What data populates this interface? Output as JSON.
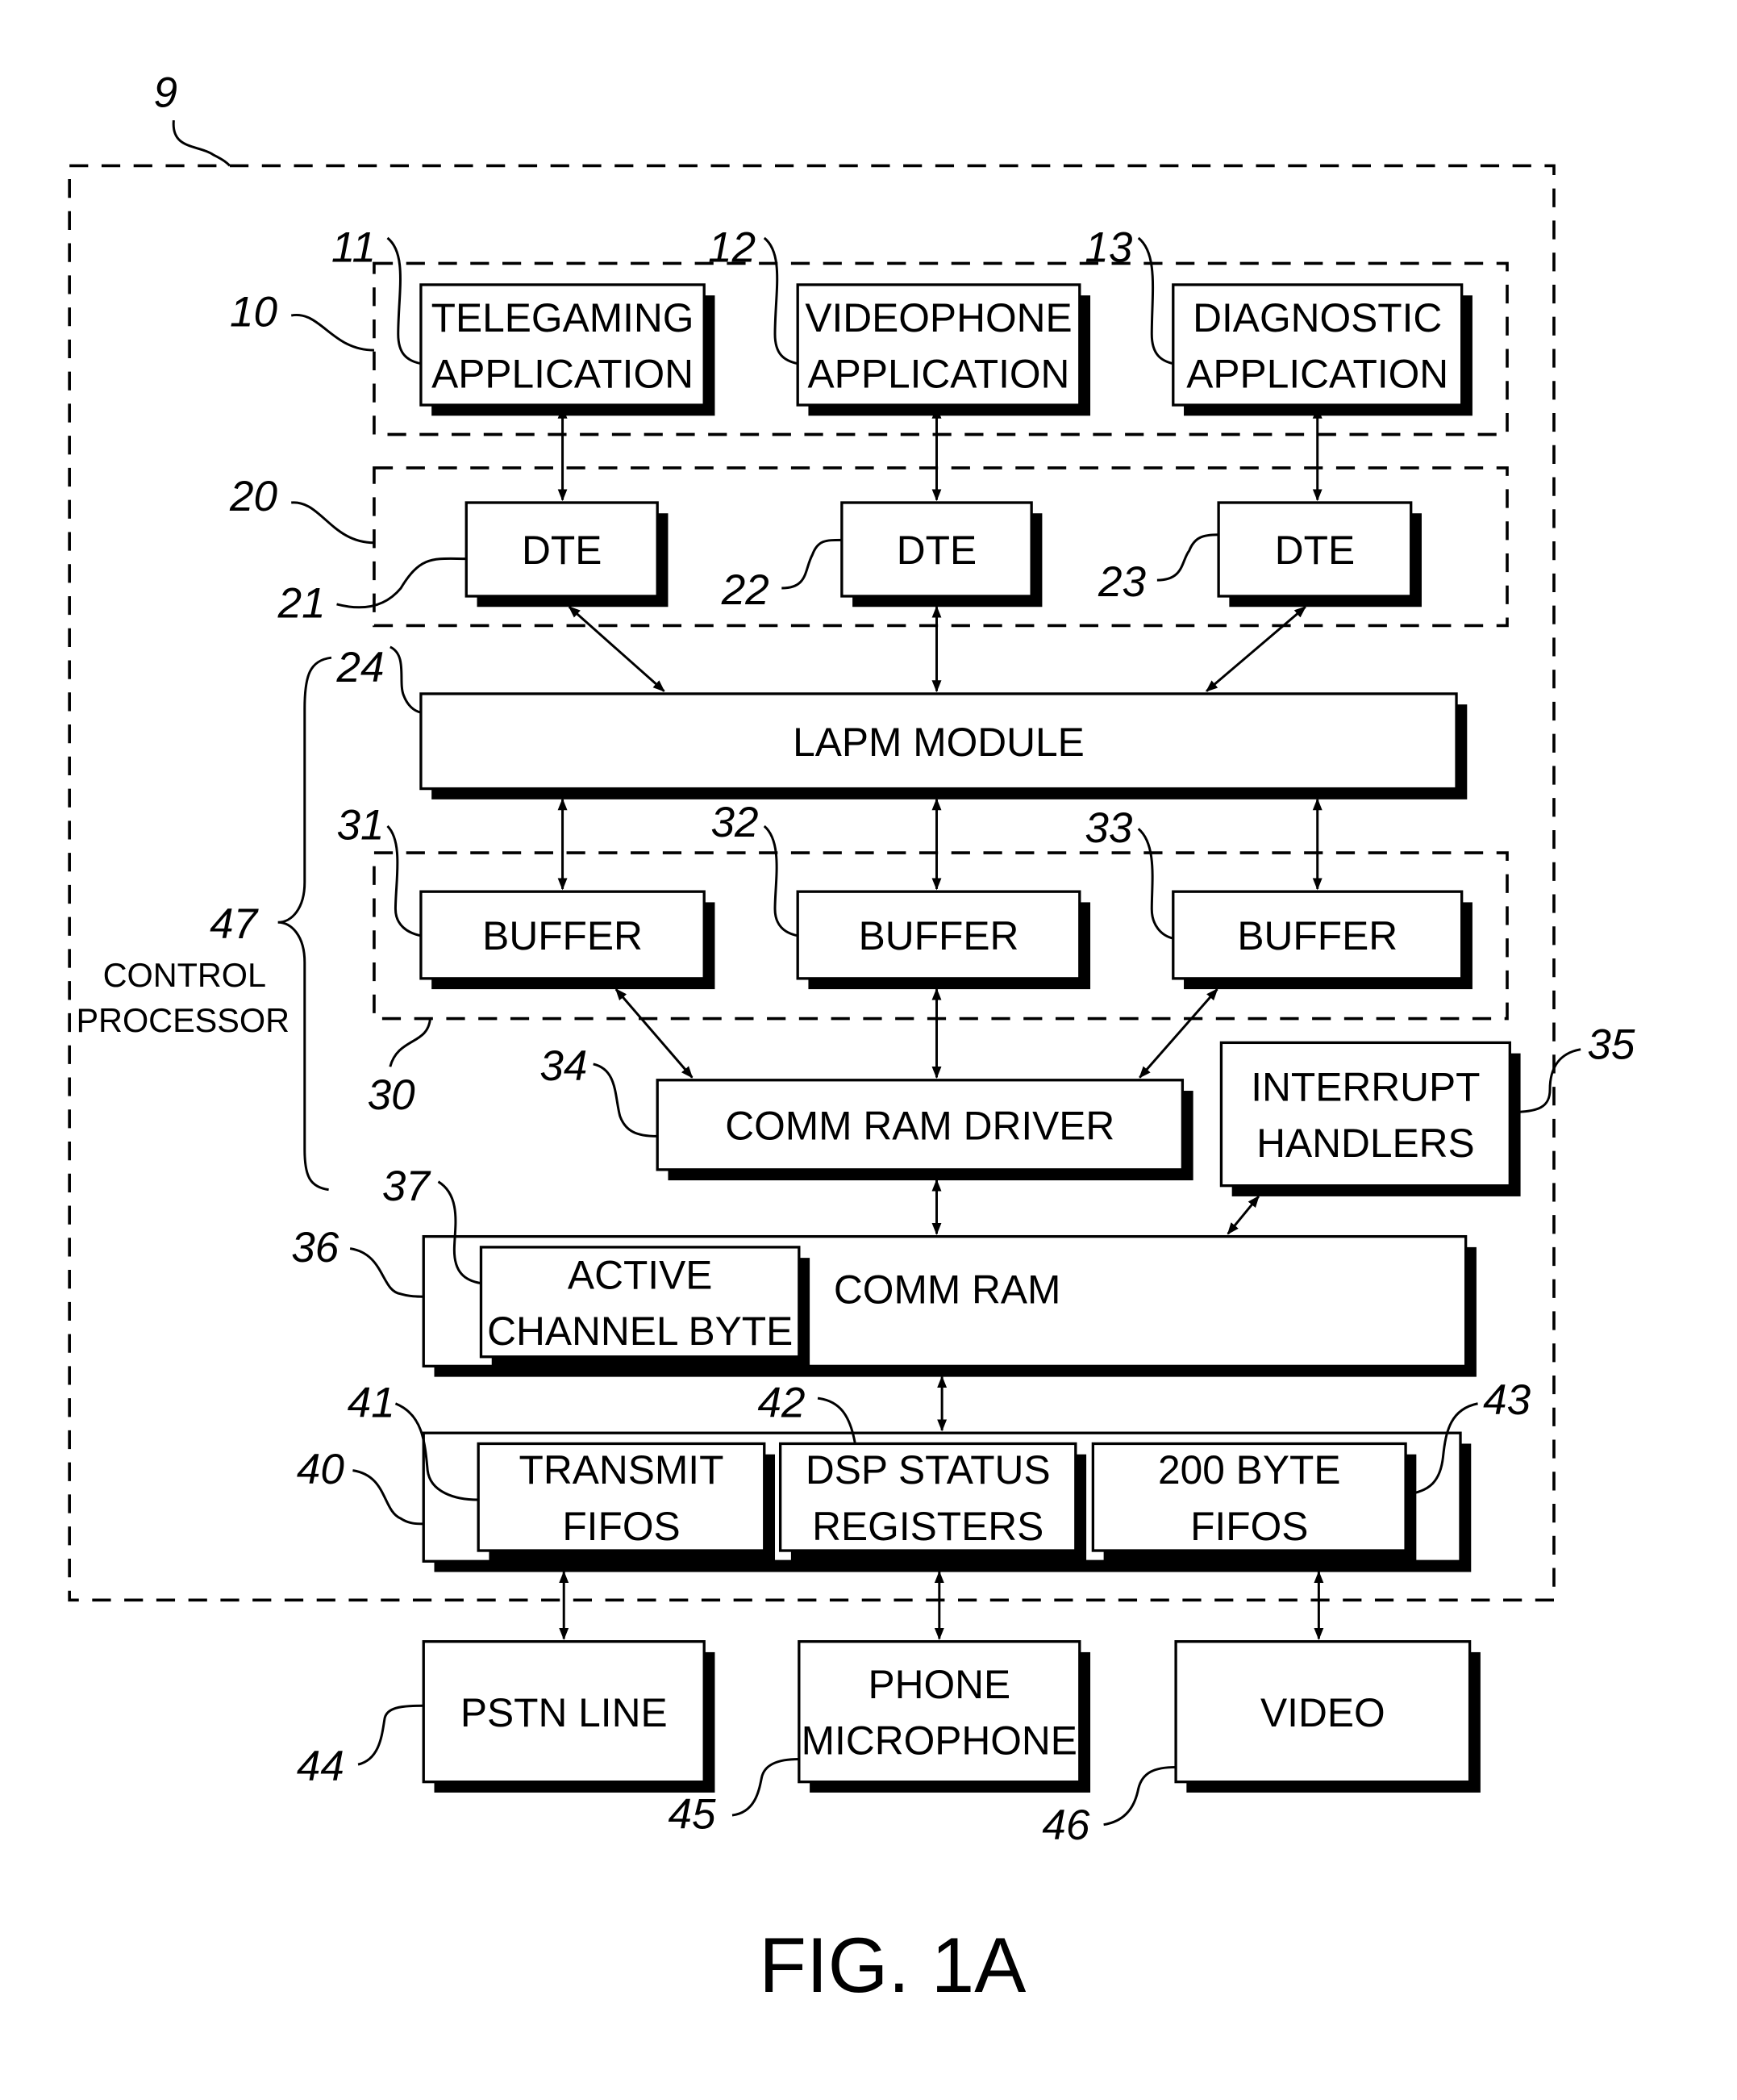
{
  "figure": {
    "caption": "FIG. 1A",
    "system_ref": "9"
  },
  "groups": {
    "applications": {
      "ref": "10"
    },
    "dtes": {
      "ref": "20"
    },
    "buffers": {
      "ref": "30"
    },
    "fifos": {
      "ref": "40"
    }
  },
  "blocks": {
    "telegaming": {
      "ref": "11",
      "lines": [
        "TELEGAMING",
        "APPLICATION"
      ]
    },
    "videophone": {
      "ref": "12",
      "lines": [
        "VIDEOPHONE",
        "APPLICATION"
      ]
    },
    "diagnostic": {
      "ref": "13",
      "lines": [
        "DIAGNOSTIC",
        "APPLICATION"
      ]
    },
    "dte1": {
      "ref": "21",
      "lines": [
        "DTE"
      ]
    },
    "dte2": {
      "ref": "22",
      "lines": [
        "DTE"
      ]
    },
    "dte3": {
      "ref": "23",
      "lines": [
        "DTE"
      ]
    },
    "lapm": {
      "ref": "24",
      "lines": [
        "LAPM MODULE"
      ]
    },
    "buffer1": {
      "ref": "31",
      "lines": [
        "BUFFER"
      ]
    },
    "buffer2": {
      "ref": "32",
      "lines": [
        "BUFFER"
      ]
    },
    "buffer3": {
      "ref": "33",
      "lines": [
        "BUFFER"
      ]
    },
    "comm_ram_driver": {
      "ref": "34",
      "lines": [
        "COMM RAM DRIVER"
      ]
    },
    "interrupt_handlers": {
      "ref": "35",
      "lines": [
        "INTERRUPT",
        "HANDLERS"
      ]
    },
    "comm_ram": {
      "ref": "36",
      "lines": [
        "COMM RAM"
      ]
    },
    "active_channel_byte": {
      "ref": "37",
      "lines": [
        "ACTIVE",
        "CHANNEL BYTE"
      ]
    },
    "transmit_fifos": {
      "ref": "41",
      "lines": [
        "TRANSMIT",
        "FIFOS"
      ]
    },
    "dsp_status_registers": {
      "ref": "42",
      "lines": [
        "DSP STATUS",
        "REGISTERS"
      ]
    },
    "byte_fifos": {
      "ref": "43",
      "lines": [
        "200 BYTE",
        "FIFOS"
      ]
    },
    "pstn_line": {
      "ref": "44",
      "lines": [
        "PSTN LINE"
      ]
    },
    "phone_microphone": {
      "ref": "45",
      "lines": [
        "PHONE",
        "MICROPHONE"
      ]
    },
    "video": {
      "ref": "46",
      "lines": [
        "VIDEO"
      ]
    }
  },
  "control_processor": {
    "ref": "47",
    "lines": [
      "CONTROL",
      "PROCESSOR"
    ]
  }
}
